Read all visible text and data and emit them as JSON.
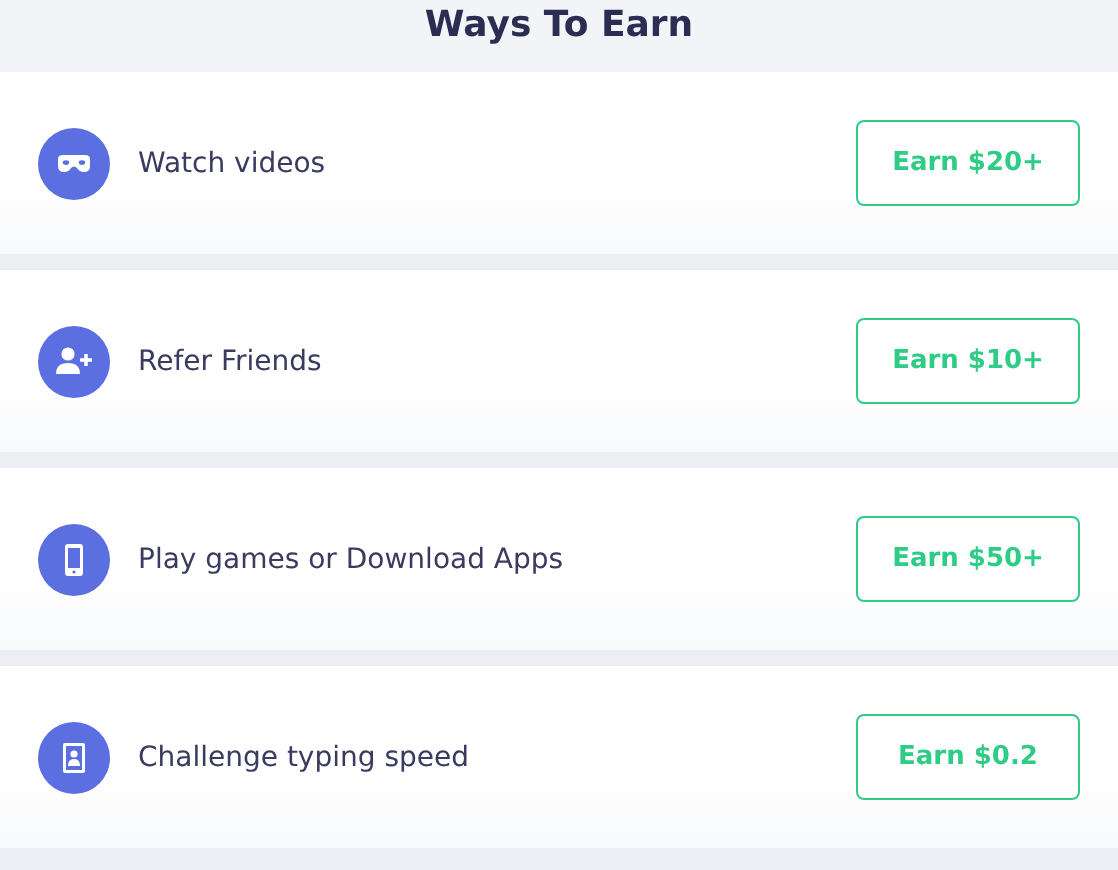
{
  "title": "Ways To Earn",
  "items": [
    {
      "kind": "mask",
      "label": "Watch videos",
      "button": "Earn $20+"
    },
    {
      "kind": "user-plus",
      "label": "Refer Friends",
      "button": "Earn $10+"
    },
    {
      "kind": "phone",
      "label": "Play games or Download Apps",
      "button": "Earn $50+"
    },
    {
      "kind": "id-card",
      "label": "Challenge typing speed",
      "button": "Earn $0.2"
    }
  ]
}
